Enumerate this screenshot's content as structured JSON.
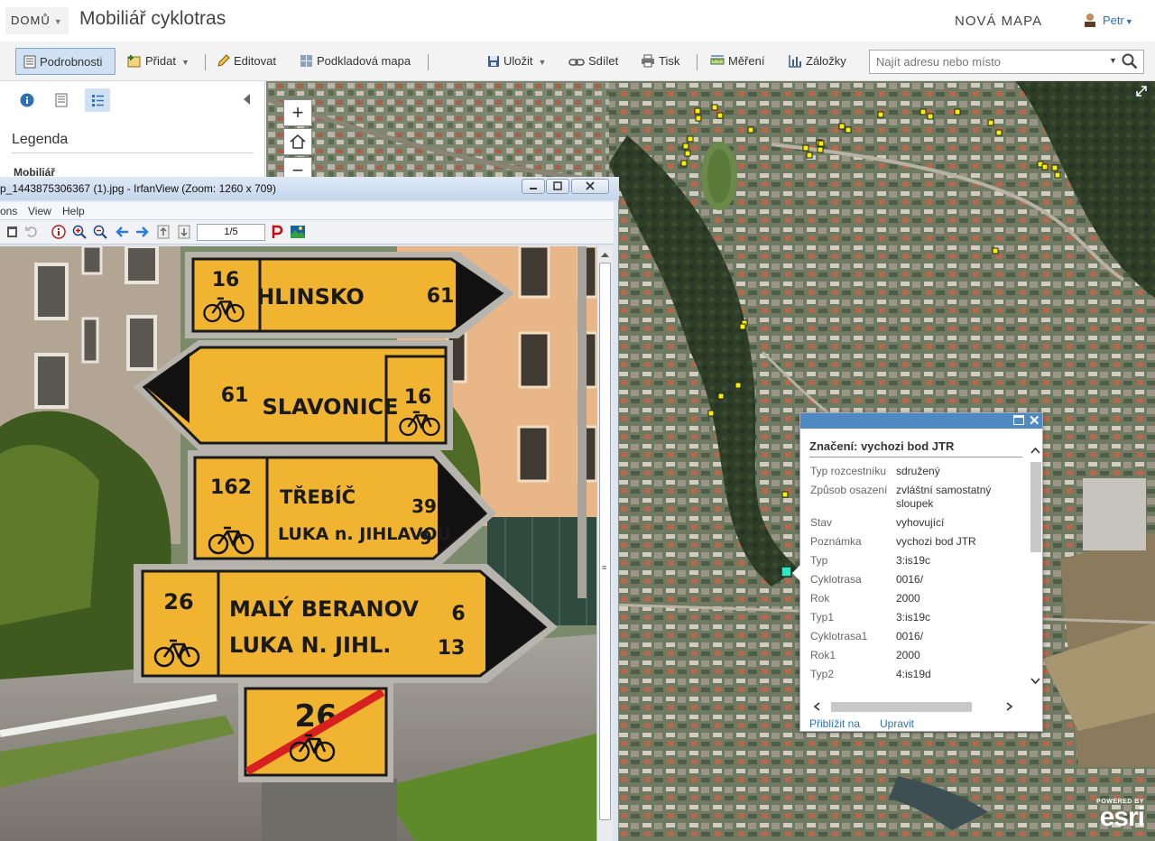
{
  "header": {
    "home_label": "DOMŮ",
    "map_title": "Mobiliář cyklotras",
    "new_map_label": "NOVÁ MAPA",
    "user_name": "Petr"
  },
  "toolbar": {
    "details_label": "Podrobnosti",
    "add_label": "Přidat",
    "edit_label": "Editovat",
    "basemap_label": "Podkladová mapa",
    "save_label": "Uložit",
    "share_label": "Sdílet",
    "print_label": "Tisk",
    "measure_label": "Měření",
    "bookmarks_label": "Záložky",
    "search_placeholder": "Najít adresu nebo místo"
  },
  "left_panel": {
    "legend_title": "Legenda",
    "layer_name": "Mobiliář"
  },
  "map": {
    "marker_color": "#f7f200",
    "selected_marker_color": "#30e8c0"
  },
  "popup": {
    "title": "Značení: vychozi bod JTR",
    "fields": [
      {
        "label": "Typ rozcestníku",
        "value": "sdružený"
      },
      {
        "label": "Způsob osazení",
        "value": "zvláštní samostatný sloupek"
      },
      {
        "label": "Stav",
        "value": "vyhovující"
      },
      {
        "label": "Poznámka",
        "value": "vychozi bod JTR"
      },
      {
        "label": "Typ",
        "value": "3:is19c"
      },
      {
        "label": "Cyklotrasa",
        "value": "0016/"
      },
      {
        "label": "Rok",
        "value": "2000"
      },
      {
        "label": "Typ1",
        "value": "3:is19c"
      },
      {
        "label": "Cyklotrasa1",
        "value": "0016/"
      },
      {
        "label": "Rok1",
        "value": "2000"
      },
      {
        "label": "Typ2",
        "value": "4:is19d"
      }
    ],
    "zoom_label": "Přiblížit na",
    "edit_label": "Upravit"
  },
  "irfanview": {
    "title": "p_1443875306367 (1).jpg - IrfanView (Zoom: 1260 x 709)",
    "menu": [
      "ons",
      "View",
      "Help"
    ],
    "page_counter": "1/5",
    "signs": {
      "hlinsko": {
        "route": "16",
        "place": "HLINSKO",
        "km": "61"
      },
      "slavonice": {
        "km": "61",
        "place": "SLAVONICE",
        "route": "16"
      },
      "trebic": {
        "route": "162",
        "place1": "TŘEBÍČ",
        "km1": "39",
        "place2": "LUKA n. JIHLAVOU",
        "km2": "9"
      },
      "maly_beranov": {
        "route": "26",
        "place1": "MALÝ BERANOV",
        "km1": "6",
        "place2": "LUKA N. JIHL.",
        "km2": "13"
      },
      "end_route": {
        "route": "26"
      }
    }
  },
  "esri": {
    "powered_by": "POWERED BY",
    "brand": "esri"
  }
}
